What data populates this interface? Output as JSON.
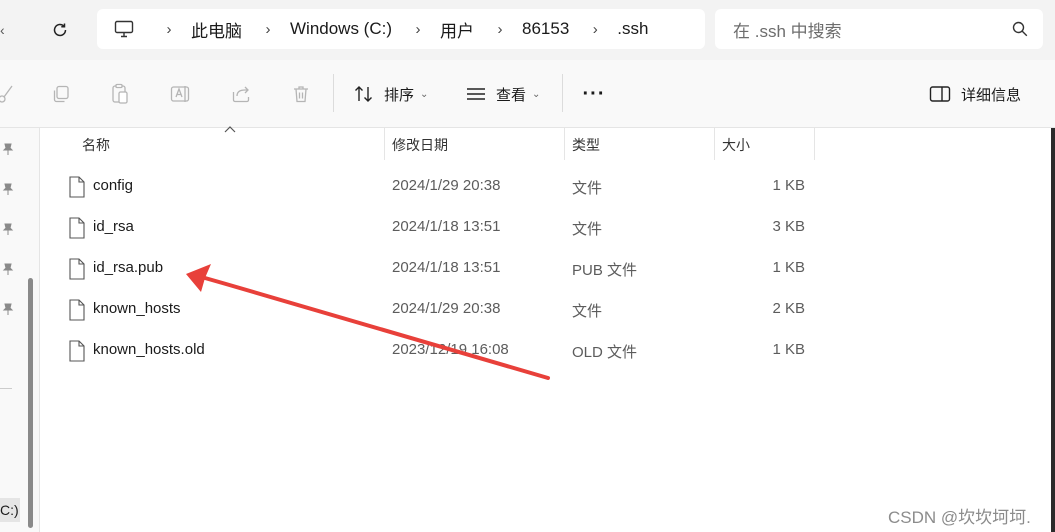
{
  "breadcrumb": [
    "此电脑",
    "Windows (C:)",
    "用户",
    "86153",
    ".ssh"
  ],
  "search": {
    "placeholder": "在 .ssh 中搜索"
  },
  "toolbar": {
    "sort_label": "排序",
    "view_label": "查看",
    "more_label": "···",
    "details_label": "详细信息"
  },
  "columns": {
    "name": "名称",
    "date": "修改日期",
    "type": "类型",
    "size": "大小"
  },
  "files": [
    {
      "name": "config",
      "date": "2024/1/29 20:38",
      "type": "文件",
      "size": "1 KB"
    },
    {
      "name": "id_rsa",
      "date": "2024/1/18 13:51",
      "type": "文件",
      "size": "3 KB"
    },
    {
      "name": "id_rsa.pub",
      "date": "2024/1/18 13:51",
      "type": "PUB 文件",
      "size": "1 KB"
    },
    {
      "name": "known_hosts",
      "date": "2024/1/29 20:38",
      "type": "文件",
      "size": "2 KB"
    },
    {
      "name": "known_hosts.old",
      "date": "2023/12/19 16:08",
      "type": "OLD 文件",
      "size": "1 KB"
    }
  ],
  "nav": {
    "drive_label": "C:)"
  },
  "watermark": "CSDN @坎坎坷坷.",
  "colors": {
    "annotation_arrow": "#e8403a",
    "window_bg": "#f3f3f3"
  }
}
